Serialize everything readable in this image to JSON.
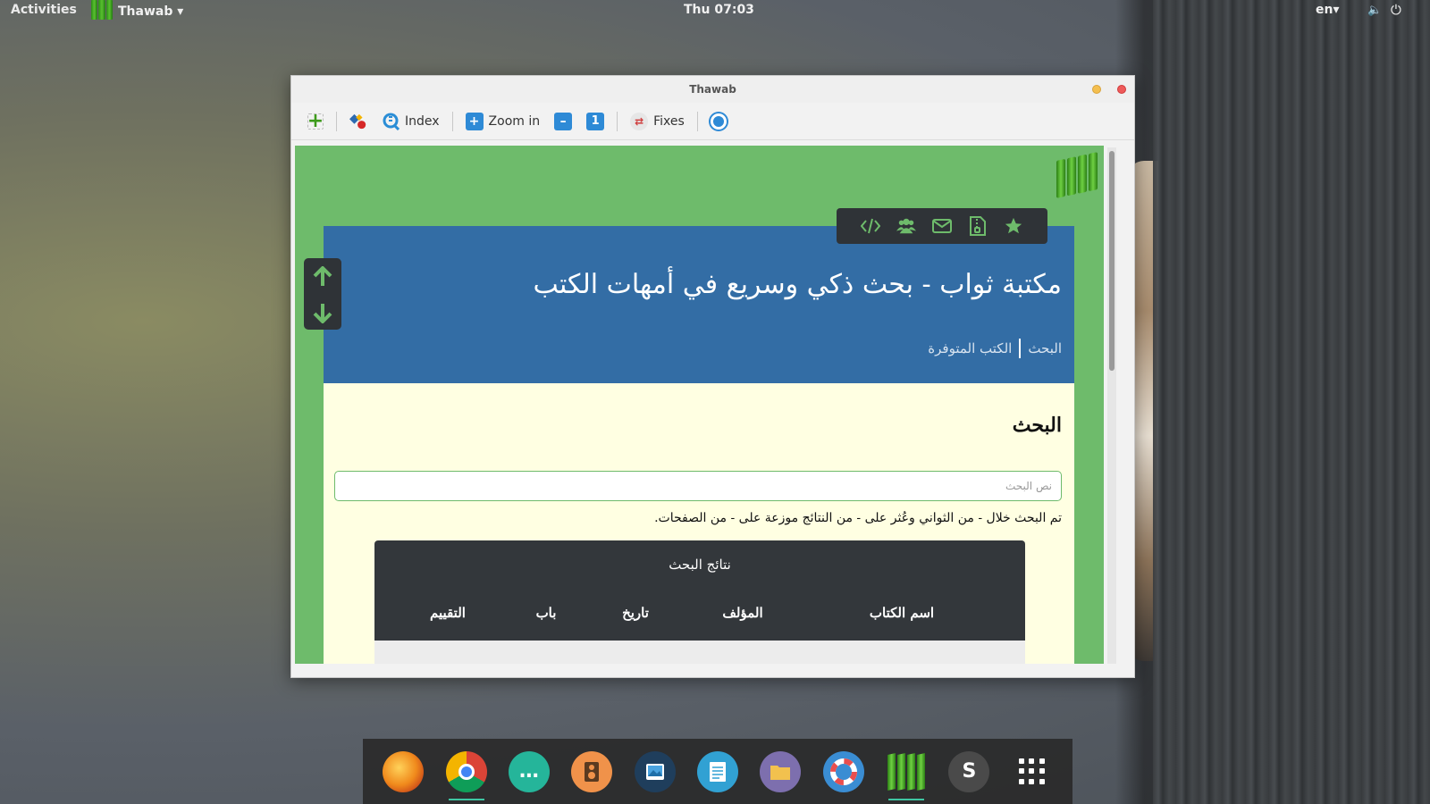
{
  "topbar": {
    "activities": "Activities",
    "app_name": "Thawab ▾",
    "clock": "Thu 07:03",
    "lang": "en▾",
    "volume_icon": "volume-icon",
    "power_icon": "power-icon"
  },
  "window": {
    "title": "Thawab"
  },
  "toolbar": {
    "new_icon": "+",
    "import_icon": "import-icon",
    "index_label": "Index",
    "zoom_in_label": "Zoom in",
    "fixes_label": "Fixes",
    "one_label": "1"
  },
  "page": {
    "title": "مكتبة ثواب - بحث ذكي وسريع في أمهات الكتب",
    "nav_search": "البحث",
    "nav_books": "الكتب المتوفرة",
    "section_heading": "البحث",
    "search_placeholder": "نص البحث",
    "search_value": "",
    "summary": "تم البحث خلال - من الثواني وعُثر على - من النتائج موزعة على - من الصفحات.",
    "results_caption": "نتائج البحث",
    "columns": [
      "اسم الكتاب",
      "المؤلف",
      "تاريخ",
      "باب",
      "التقييم"
    ]
  },
  "share_icons": [
    "code-icon",
    "users-icon",
    "envelope-icon",
    "file-zip-icon",
    "star-icon"
  ],
  "dock": [
    "firefox",
    "chrome",
    "chat",
    "music",
    "photos",
    "documents",
    "files",
    "help",
    "thawab",
    "sublime",
    "app-grid"
  ],
  "colors": {
    "page_green": "#6ebb6b",
    "hero_blue": "#336da5",
    "panel_cream": "#ffffe2",
    "dark": "#2f3337"
  }
}
